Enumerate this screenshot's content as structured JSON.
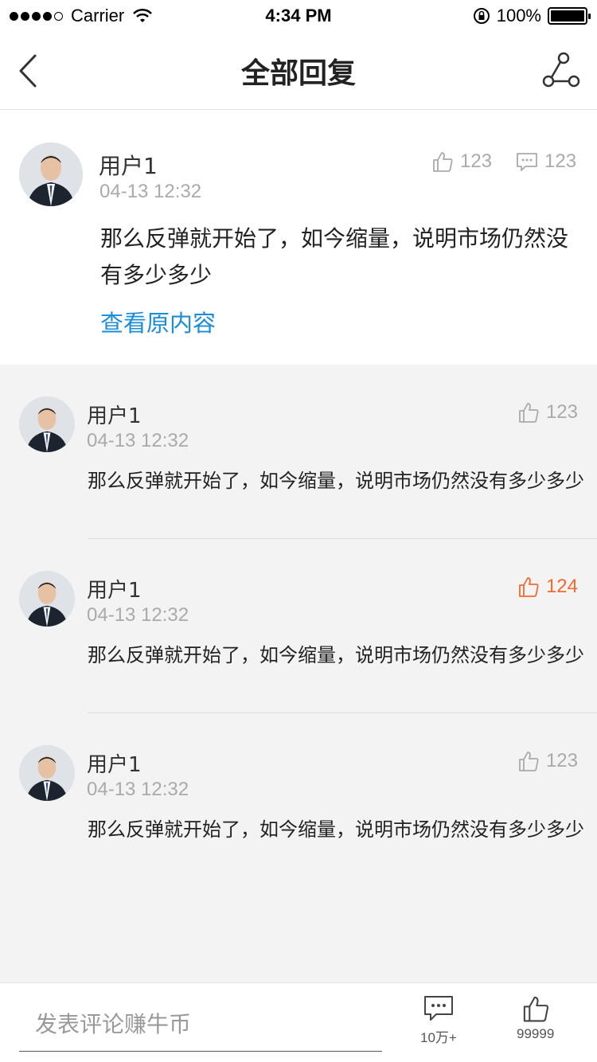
{
  "status_bar": {
    "carrier": "Carrier",
    "time": "4:34 PM",
    "battery": "100%"
  },
  "nav": {
    "title": "全部回复"
  },
  "main_comment": {
    "username": "用户1",
    "timestamp": "04-13  12:32",
    "likes": "123",
    "comments": "123",
    "text": "那么反弹就开始了，如今缩量，说明市场仍然没有多少多少",
    "link": "查看原内容"
  },
  "replies": [
    {
      "username": "用户1",
      "timestamp": "04-13  12:32",
      "likes": "123",
      "liked": false,
      "text": "那么反弹就开始了，如今缩量，说明市场仍然没有多少多少"
    },
    {
      "username": "用户1",
      "timestamp": "04-13  12:32",
      "likes": "124",
      "liked": true,
      "text": "那么反弹就开始了，如今缩量，说明市场仍然没有多少多少"
    },
    {
      "username": "用户1",
      "timestamp": "04-13  12:32",
      "likes": "123",
      "liked": false,
      "text": "那么反弹就开始了，如今缩量，说明市场仍然没有多少多少"
    }
  ],
  "bottom_bar": {
    "input_placeholder": "发表评论赚牛币",
    "comment_count": "10万+",
    "like_count": "99999"
  },
  "colors": {
    "link": "#1a8cd8",
    "liked": "#f26a2e",
    "muted": "#aaaaaa",
    "replies_bg": "#f3f3f3"
  },
  "icons": [
    "back-arrow-icon",
    "share-icon",
    "thumbs-up-icon",
    "comment-bubble-icon",
    "wifi-icon",
    "lock-rotation-icon",
    "battery-icon"
  ]
}
